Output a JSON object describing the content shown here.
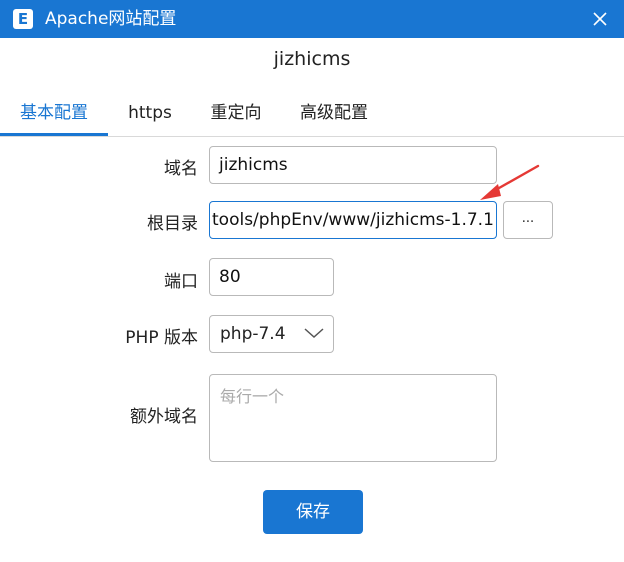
{
  "window": {
    "title": "Apache网站配置",
    "icon_letter": "E",
    "accent_color": "#1976d2"
  },
  "site_title": "jizhicms",
  "tabs": [
    {
      "label": "基本配置",
      "active": true
    },
    {
      "label": "https",
      "active": false
    },
    {
      "label": "重定向",
      "active": false
    },
    {
      "label": "高级配置",
      "active": false
    }
  ],
  "form": {
    "domain": {
      "label": "域名",
      "value": "jizhicms"
    },
    "root": {
      "label": "根目录",
      "value": "tools/phpEnv/www/jizhicms-1.7.1",
      "browse_label": "..."
    },
    "port": {
      "label": "端口",
      "value": "80"
    },
    "php_version": {
      "label": "PHP 版本",
      "value": "php-7.4"
    },
    "extra_domains": {
      "label": "额外域名",
      "placeholder": "每行一个"
    }
  },
  "save_label": "保存",
  "annotation": {
    "type": "red-arrow-icon",
    "color": "#e53935"
  }
}
